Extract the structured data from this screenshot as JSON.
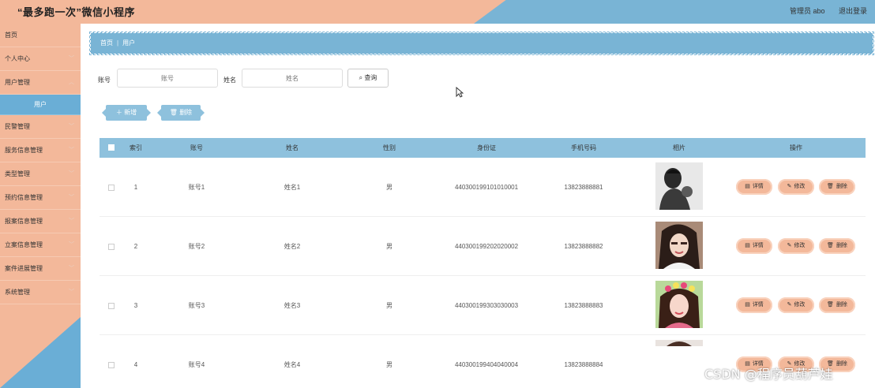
{
  "header": {
    "title": "“最多跑一次”微信小程序",
    "admin": "管理员 abo",
    "logout": "退出登录"
  },
  "sidebar": {
    "items": [
      {
        "label": "首页",
        "chevron": false
      },
      {
        "label": "个人中心",
        "chevron": true
      },
      {
        "label": "用户管理",
        "chevron": true
      },
      {
        "label": "用户",
        "sub": true
      },
      {
        "label": "民警管理",
        "chevron": true
      },
      {
        "label": "服务信息管理",
        "chevron": true
      },
      {
        "label": "类型管理",
        "chevron": true
      },
      {
        "label": "预约信息管理",
        "chevron": true
      },
      {
        "label": "报案信息管理",
        "chevron": true
      },
      {
        "label": "立案信息管理",
        "chevron": true
      },
      {
        "label": "案件进展管理",
        "chevron": true
      },
      {
        "label": "系统管理",
        "chevron": true
      }
    ]
  },
  "breadcrumb": {
    "home": "首页",
    "separator": "|",
    "current": "用户"
  },
  "search": {
    "account_label": "账号",
    "account_placeholder": "账号",
    "name_label": "姓名",
    "name_placeholder": "姓名",
    "button": "查询"
  },
  "actions": {
    "add": "新增",
    "delete": "删除"
  },
  "table": {
    "headers": [
      "索引",
      "账号",
      "姓名",
      "性别",
      "身份证",
      "手机号码",
      "相片",
      "操作"
    ],
    "rows": [
      {
        "index": "1",
        "account": "账号1",
        "name": "姓名1",
        "gender": "男",
        "id_card": "440300199101010001",
        "phone": "13823888881",
        "photo": "monochrome portrait"
      },
      {
        "index": "2",
        "account": "账号2",
        "name": "姓名2",
        "gender": "男",
        "id_card": "440300199202020002",
        "phone": "13823888882",
        "photo": "woman portrait"
      },
      {
        "index": "3",
        "account": "账号3",
        "name": "姓名3",
        "gender": "男",
        "id_card": "440300199303030003",
        "phone": "13823888883",
        "photo": "woman with flower crown"
      },
      {
        "index": "4",
        "account": "账号4",
        "name": "姓名4",
        "gender": "男",
        "id_card": "440300199404040004",
        "phone": "13823888884",
        "photo": "portrait"
      }
    ],
    "row_actions": {
      "detail": "详情",
      "edit": "修改",
      "delete": "删除"
    }
  },
  "watermark": "CSDN @程序员葫芦娃",
  "colors": {
    "peach": "#f3b89a",
    "blue": "#79b4d5",
    "table_header": "#8ec1dd"
  }
}
